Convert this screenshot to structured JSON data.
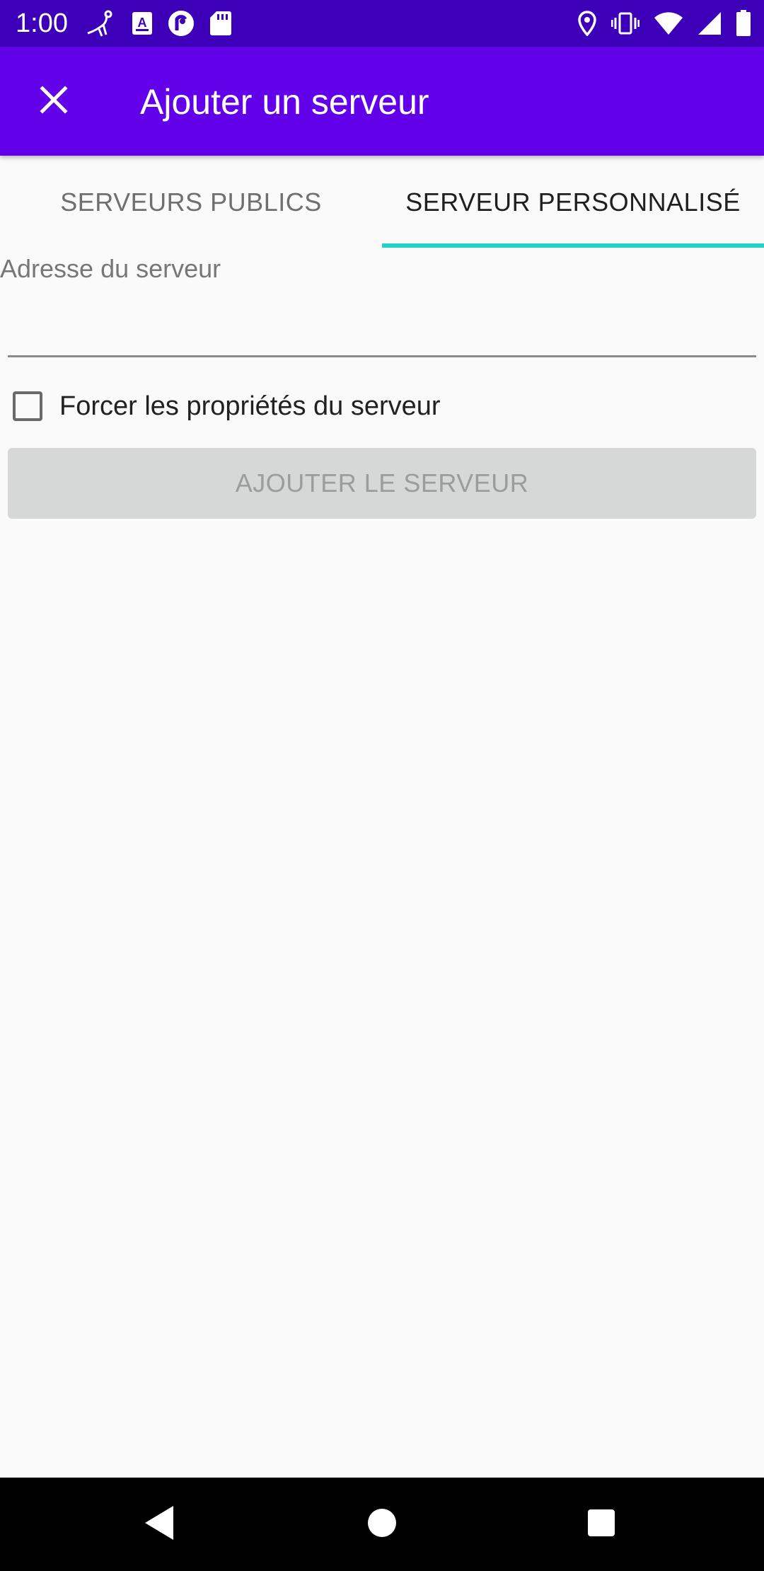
{
  "status_bar": {
    "time": "1:00",
    "left_icons": [
      "bird-icon",
      "font-download-icon",
      "pocket-casts-icon",
      "sd-card-icon"
    ],
    "right_icons": [
      "location-icon",
      "vibrate-icon",
      "wifi-icon",
      "signal-icon",
      "battery-icon"
    ]
  },
  "app_bar": {
    "title": "Ajouter un serveur",
    "close_icon": "close-icon",
    "background": "#6200ea"
  },
  "tabs": [
    {
      "label": "SERVEURS PUBLICS",
      "selected": false
    },
    {
      "label": "SERVEUR PERSONNALISÉ",
      "selected": true
    }
  ],
  "form": {
    "address_label": "Adresse du serveur",
    "address_value": "",
    "force_properties_label": "Forcer les propriétés du serveur",
    "force_properties_checked": false,
    "add_button_label": "AJOUTER LE SERVEUR",
    "add_button_enabled": false
  },
  "nav_bar": {
    "buttons": [
      "back-icon",
      "home-icon",
      "recents-icon"
    ]
  },
  "colors": {
    "status_bar": "#3d00b8",
    "accent": "#1fd3c6"
  }
}
